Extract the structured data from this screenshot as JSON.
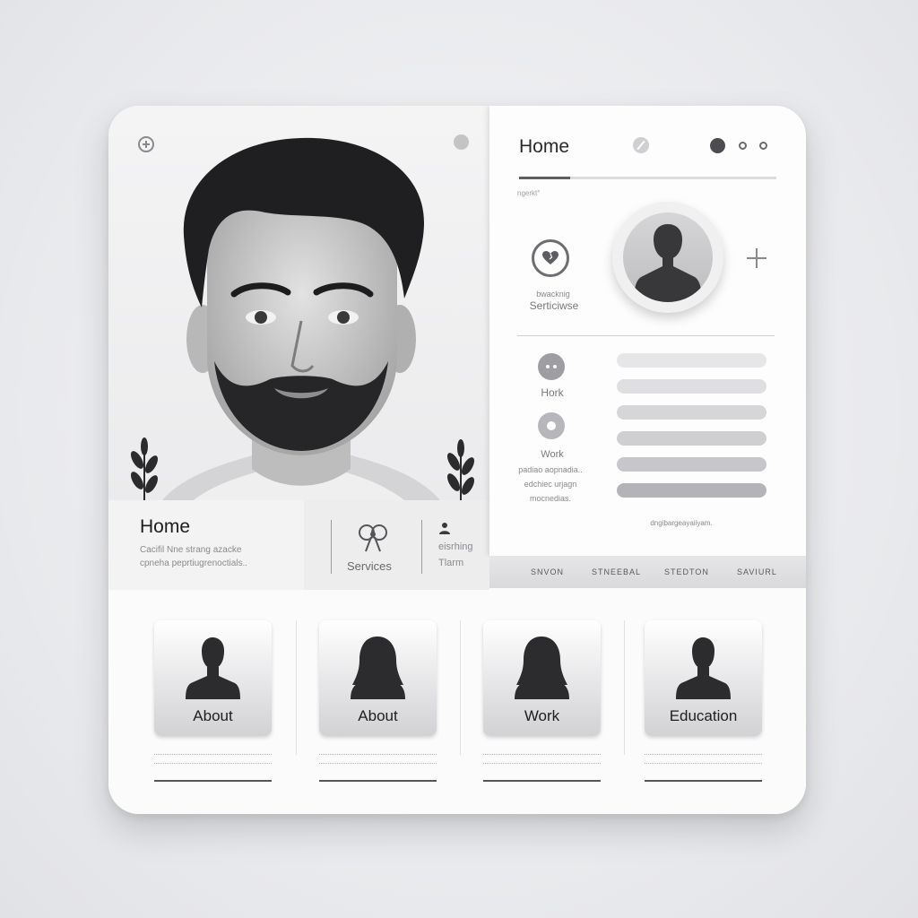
{
  "photo_panel": {
    "info": {
      "title": "Home",
      "desc_line1": "Cacifil Nne strang azacke",
      "desc_line2": "cpneha peprtiugrenoctials.."
    },
    "services": {
      "label": "Services"
    },
    "team": {
      "line1": "eisrhing",
      "line2": "Tlarm"
    }
  },
  "right_panel": {
    "title": "Home",
    "subtitle": "ngerkt°",
    "heart_caption_1": "bwacknig",
    "heart_caption_2": "Serticiwse",
    "hork_label": "Hork",
    "work_label": "Work",
    "work_desc_1": "padiao aopnadia..",
    "work_desc_2": "edchiec urjagn",
    "work_desc_3": "mocnedias.",
    "caption": "dngibargeayaiiyam.",
    "bars": [
      "#e6e6e8",
      "#dfdfe1",
      "#d6d6d9",
      "#cfcfd2",
      "#c7c7cb",
      "#b4b4b8"
    ]
  },
  "tabs": [
    "SNVON",
    "STNEEBAL",
    "STEDTON",
    "SAVIURL"
  ],
  "tiles": [
    {
      "label": "About",
      "figure": "male"
    },
    {
      "label": "About",
      "figure": "female"
    },
    {
      "label": "Work",
      "figure": "female"
    },
    {
      "label": "Education",
      "figure": "male"
    }
  ],
  "colors": {
    "background": "#e8e9ec",
    "card": "#fbfbfc",
    "accent": "#4d4d51"
  }
}
